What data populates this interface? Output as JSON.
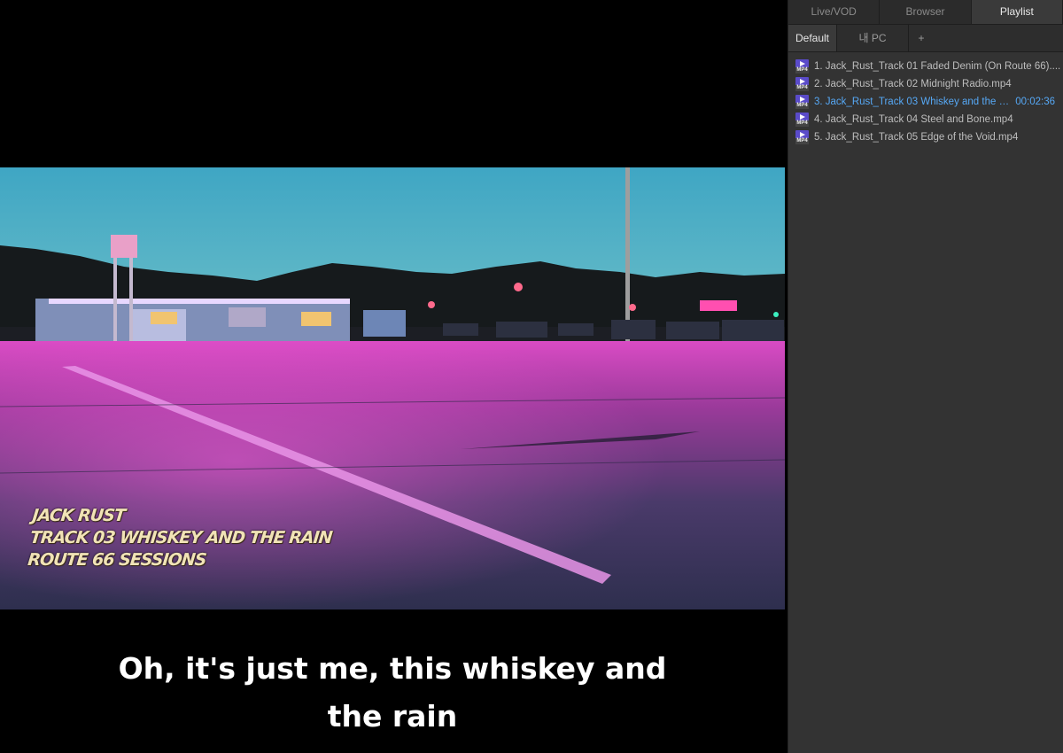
{
  "tabs": {
    "live_vod": "Live/VOD",
    "browser": "Browser",
    "playlist": "Playlist"
  },
  "subtabs": {
    "default": "Default",
    "pc": "내 PC",
    "add": "+"
  },
  "playlist": [
    {
      "title": "1. Jack_Rust_Track 01 Faded Denim (On Route 66)....",
      "duration": "",
      "icon_label": "MP4"
    },
    {
      "title": "2. Jack_Rust_Track 02 Midnight Radio.mp4",
      "duration": "",
      "icon_label": "MP4"
    },
    {
      "title": "3. Jack_Rust_Track 03 Whiskey and the Rai...",
      "duration": "00:02:36",
      "icon_label": "MP4"
    },
    {
      "title": "4. Jack_Rust_Track 04 Steel and Bone.mp4",
      "duration": "",
      "icon_label": "MP4"
    },
    {
      "title": "5. Jack_Rust_Track 05 Edge of the Void.mp4",
      "duration": "",
      "icon_label": "MP4"
    }
  ],
  "active_index": 2,
  "video": {
    "overlay_lines": [
      "JACK RUST",
      "TRACK 03 WHISKEY AND THE RAIN",
      "ROUTE 66 SESSIONS"
    ],
    "subtitle": "Oh, it's just me, this whiskey and the rain"
  },
  "colors": {
    "accent_active": "#56a8f5",
    "panel_bg": "#333333",
    "file_icon": "#5a4bc9"
  }
}
